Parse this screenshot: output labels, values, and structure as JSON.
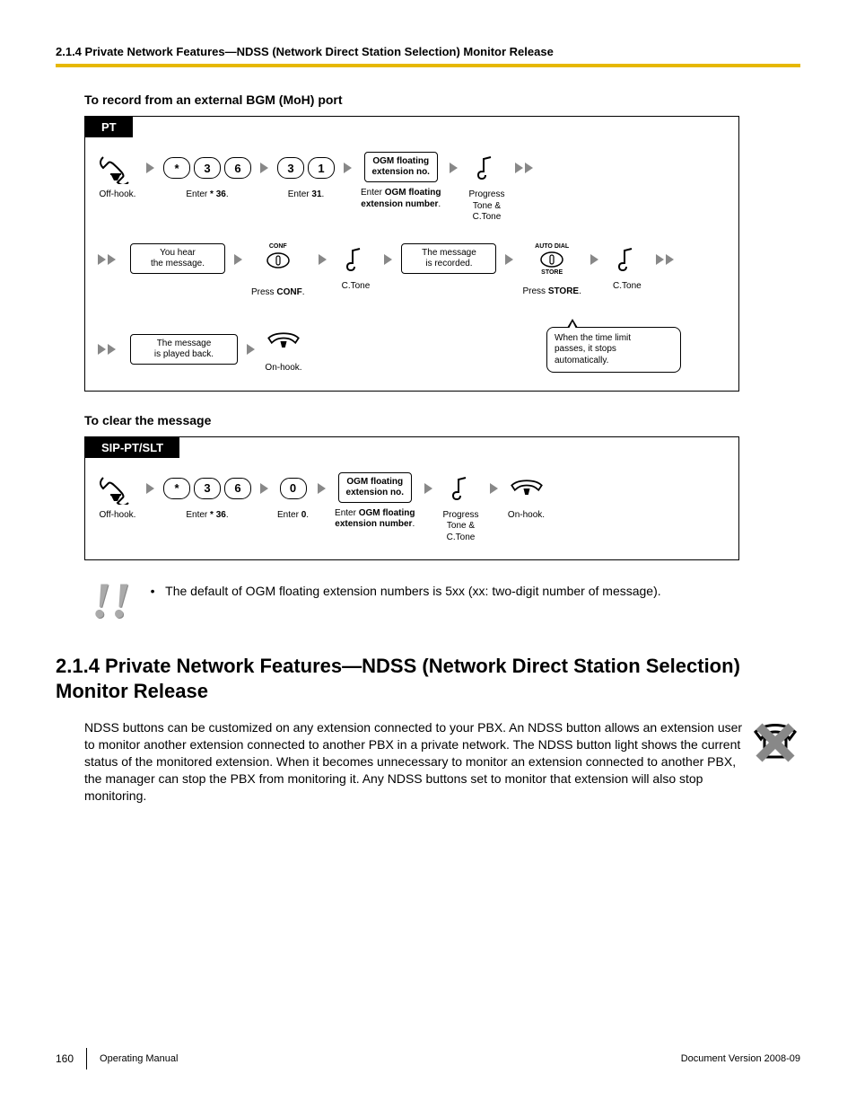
{
  "header": {
    "breadcrumb": "2.1.4 Private Network Features—NDSS (Network Direct Station Selection) Monitor Release"
  },
  "record": {
    "title": "To record from an external BGM (MoH) port",
    "tab": "PT",
    "steps": {
      "offhook": "Off-hook.",
      "enter36_keys": [
        "*",
        "3",
        "6"
      ],
      "enter36_lbl": "Enter * 36.",
      "enter31_keys": [
        "3",
        "1"
      ],
      "enter31_lbl": "Enter 31.",
      "ogm_box": "OGM floating\nextension no.",
      "ogm_lbl": "Enter OGM floating\nextension number.",
      "prog_lbl": "Progress\nTone &\nC.Tone",
      "hear": "You hear\nthe message.",
      "conf_top": "CONF",
      "conf_lbl": "Press CONF.",
      "ctone": "C.Tone",
      "recorded": "The message\nis recorded.",
      "store_top": "AUTO DIAL",
      "store_bot": "STORE",
      "store_lbl": "Press STORE.",
      "played": "The message\nis played back.",
      "onhook": "On-hook.",
      "bubble": "When the time limit\npasses, it stops\nautomatically."
    }
  },
  "clear": {
    "title": "To clear the message",
    "tab": "SIP-PT/SLT",
    "steps": {
      "offhook": "Off-hook.",
      "enter36_keys": [
        "*",
        "3",
        "6"
      ],
      "enter36_lbl": "Enter * 36.",
      "enter0_keys": [
        "0"
      ],
      "enter0_lbl": "Enter 0.",
      "ogm_box": "OGM floating\nextension no.",
      "ogm_lbl": "Enter OGM floating\nextension number.",
      "prog_lbl": "Progress\nTone &\nC.Tone",
      "onhook": "On-hook."
    }
  },
  "note": {
    "bullet": "•",
    "text": "The default of OGM floating extension numbers is 5xx (xx: two-digit number of message)."
  },
  "section": {
    "heading": "2.1.4  Private Network Features—NDSS (Network Direct Station Selection) Monitor Release",
    "body": "NDSS buttons can be customized on any extension connected to your PBX. An NDSS button allows an extension user to monitor another extension connected to another PBX in a private network. The NDSS button light shows the current status of the monitored extension. When it becomes unnecessary to monitor an extension connected to another PBX, the manager can stop the PBX from monitoring it. Any NDSS buttons set to monitor that extension will also stop monitoring."
  },
  "footer": {
    "page": "160",
    "left": "Operating Manual",
    "right": "Document Version  2008-09"
  }
}
